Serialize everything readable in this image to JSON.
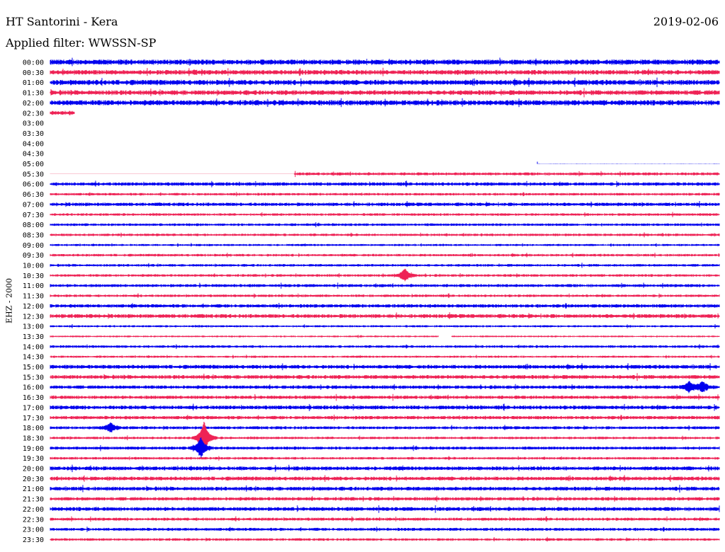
{
  "header": {
    "station": "HT Santorini - Kera",
    "date": "2019-02-06",
    "filter": "Applied filter: WWSSN-SP"
  },
  "channel": "EHZ - 2000",
  "chart_data": {
    "type": "line",
    "title": "HT Santorini - Kera",
    "subtitle": "Applied filter: WWSSN-SP",
    "xlabel": "",
    "ylabel": "EHZ - 2000",
    "grid": false,
    "legend": "none",
    "colors": {
      "odd_trace": "#0000ee",
      "even_trace": "#ee2255",
      "text": "#000000",
      "background": "#ffffff"
    },
    "rows": [
      {
        "time": "00:00",
        "coverage": [
          0,
          1
        ],
        "noise": 0.6,
        "events": []
      },
      {
        "time": "00:30",
        "coverage": [
          0,
          1
        ],
        "noise": 0.55,
        "events": []
      },
      {
        "time": "01:00",
        "coverage": [
          0,
          1
        ],
        "noise": 0.6,
        "events": []
      },
      {
        "time": "01:30",
        "coverage": [
          0,
          1
        ],
        "noise": 0.55,
        "events": []
      },
      {
        "time": "02:00",
        "coverage": [
          0,
          1
        ],
        "noise": 0.6,
        "events": []
      },
      {
        "time": "02:30",
        "coverage": [
          0,
          0.037
        ],
        "noise": 0.5,
        "events": []
      },
      {
        "time": "03:00",
        "coverage": [],
        "noise": 0,
        "events": []
      },
      {
        "time": "03:30",
        "coverage": [],
        "noise": 0,
        "events": []
      },
      {
        "time": "04:00",
        "coverage": [],
        "noise": 0,
        "events": []
      },
      {
        "time": "04:30",
        "coverage": [],
        "noise": 0,
        "events": []
      },
      {
        "time": "05:00",
        "coverage": [
          0.728,
          1
        ],
        "noise": 0.03,
        "events": []
      },
      {
        "time": "05:30",
        "coverage": [
          0,
          1
        ],
        "noise": 0.35,
        "flat_until": 0.365,
        "events": []
      },
      {
        "time": "06:00",
        "coverage": [
          0,
          1
        ],
        "noise": 0.4,
        "events": []
      },
      {
        "time": "06:30",
        "coverage": [
          0,
          1
        ],
        "noise": 0.3,
        "events": []
      },
      {
        "time": "07:00",
        "coverage": [
          0,
          1
        ],
        "noise": 0.4,
        "events": []
      },
      {
        "time": "07:30",
        "coverage": [
          0,
          1
        ],
        "noise": 0.3,
        "events": []
      },
      {
        "time": "08:00",
        "coverage": [
          0,
          1
        ],
        "noise": 0.3,
        "events": []
      },
      {
        "time": "08:30",
        "coverage": [
          0,
          1
        ],
        "noise": 0.3,
        "events": []
      },
      {
        "time": "09:00",
        "coverage": [
          0,
          1
        ],
        "noise": 0.25,
        "events": []
      },
      {
        "time": "09:30",
        "coverage": [
          0,
          1
        ],
        "noise": 0.3,
        "events": []
      },
      {
        "time": "10:00",
        "coverage": [
          0,
          1
        ],
        "noise": 0.3,
        "events": []
      },
      {
        "time": "10:30",
        "coverage": [
          0,
          1
        ],
        "noise": 0.3,
        "events": [
          {
            "at": 0.53,
            "amp": 1.4
          }
        ]
      },
      {
        "time": "11:00",
        "coverage": [
          0,
          1
        ],
        "noise": 0.35,
        "events": []
      },
      {
        "time": "11:30",
        "coverage": [
          0,
          1
        ],
        "noise": 0.3,
        "events": []
      },
      {
        "time": "12:00",
        "coverage": [
          0,
          1
        ],
        "noise": 0.4,
        "events": []
      },
      {
        "time": "12:30",
        "coverage": [
          0,
          1
        ],
        "noise": 0.45,
        "events": []
      },
      {
        "time": "13:00",
        "coverage": [
          0,
          1
        ],
        "noise": 0.25,
        "events": []
      },
      {
        "time": "13:30",
        "coverage": [
          0,
          0.58,
          0.6,
          1
        ],
        "noise": 0.2,
        "events": []
      },
      {
        "time": "14:00",
        "coverage": [
          0,
          1
        ],
        "noise": 0.3,
        "events": []
      },
      {
        "time": "14:30",
        "coverage": [
          0,
          1
        ],
        "noise": 0.25,
        "events": []
      },
      {
        "time": "15:00",
        "coverage": [
          0,
          1
        ],
        "noise": 0.45,
        "events": []
      },
      {
        "time": "15:30",
        "coverage": [
          0,
          1
        ],
        "noise": 0.45,
        "events": []
      },
      {
        "time": "16:00",
        "coverage": [
          0,
          1
        ],
        "noise": 0.4,
        "events": [
          {
            "at": 0.955,
            "amp": 1.1
          },
          {
            "at": 0.975,
            "amp": 1.1
          }
        ]
      },
      {
        "time": "16:30",
        "coverage": [
          0,
          1
        ],
        "noise": 0.4,
        "events": []
      },
      {
        "time": "17:00",
        "coverage": [
          0,
          1
        ],
        "noise": 0.45,
        "events": []
      },
      {
        "time": "17:30",
        "coverage": [
          0,
          1
        ],
        "noise": 0.4,
        "events": []
      },
      {
        "time": "18:00",
        "coverage": [
          0,
          1
        ],
        "noise": 0.35,
        "events": [
          {
            "at": 0.09,
            "amp": 1.0
          }
        ]
      },
      {
        "time": "18:30",
        "coverage": [
          0,
          1
        ],
        "noise": 0.3,
        "events": [
          {
            "at": 0.23,
            "amp": 3.5
          }
        ]
      },
      {
        "time": "19:00",
        "coverage": [
          0,
          1
        ],
        "noise": 0.35,
        "events": [
          {
            "at": 0.225,
            "amp": 2.2
          }
        ]
      },
      {
        "time": "19:30",
        "coverage": [
          0,
          1
        ],
        "noise": 0.3,
        "events": []
      },
      {
        "time": "20:00",
        "coverage": [
          0,
          1
        ],
        "noise": 0.45,
        "events": []
      },
      {
        "time": "20:30",
        "coverage": [
          0,
          1
        ],
        "noise": 0.45,
        "events": []
      },
      {
        "time": "21:00",
        "coverage": [
          0,
          1
        ],
        "noise": 0.45,
        "events": []
      },
      {
        "time": "21:30",
        "coverage": [
          0,
          1
        ],
        "noise": 0.4,
        "events": []
      },
      {
        "time": "22:00",
        "coverage": [
          0,
          1
        ],
        "noise": 0.45,
        "events": []
      },
      {
        "time": "22:30",
        "coverage": [
          0,
          1
        ],
        "noise": 0.35,
        "events": []
      },
      {
        "time": "23:00",
        "coverage": [
          0,
          1
        ],
        "noise": 0.35,
        "events": []
      },
      {
        "time": "23:30",
        "coverage": [
          0,
          1
        ],
        "noise": 0.3,
        "events": []
      }
    ]
  }
}
